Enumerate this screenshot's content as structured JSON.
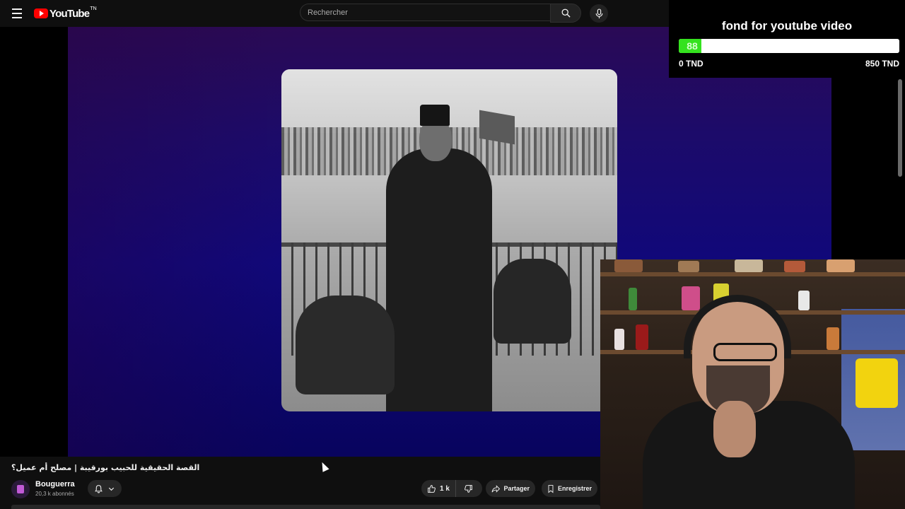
{
  "header": {
    "logo_text": "YouTube",
    "logo_sup": "TN",
    "search_placeholder": "Rechercher"
  },
  "donation": {
    "title": "fond for youtube video",
    "current": "88",
    "min_label": "0 TND",
    "max_label": "850 TND",
    "progress_fraction": 0.1035,
    "fill_color": "#35e21f"
  },
  "video": {
    "title": "القصة الحقيقية للحبيب بورقيبة | مصلح أم عميل؟",
    "channel_name": "Bouguerra",
    "subscribers": "20,3 k abonnés",
    "like_count": "1 k",
    "share_label": "Partager",
    "save_label": "Enregistrer"
  },
  "icons": {
    "menu": "menu-icon",
    "search": "search-icon",
    "mic": "mic-icon",
    "bell": "bell-icon",
    "like": "thumbs-up-icon",
    "dislike": "thumbs-down-icon",
    "share": "share-icon",
    "save": "bookmark-icon"
  }
}
